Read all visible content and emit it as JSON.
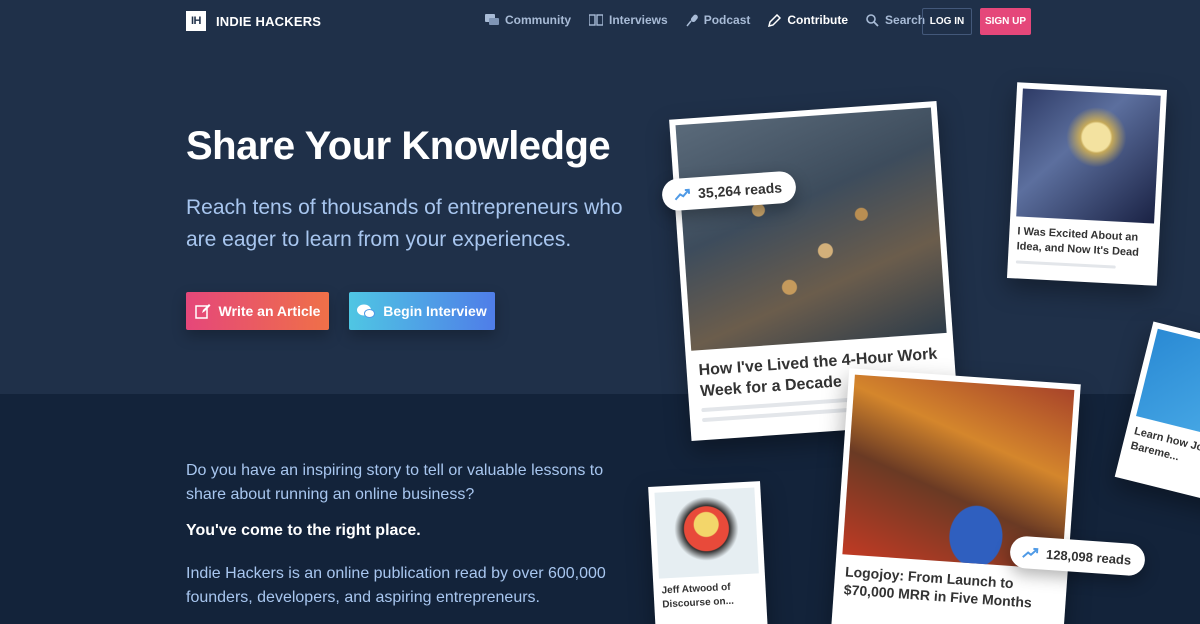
{
  "nav": {
    "logo_mark": "IH",
    "brand": "INDIE HACKERS",
    "links": [
      {
        "label": "Community",
        "icon": "chat-icon"
      },
      {
        "label": "Interviews",
        "icon": "book-icon"
      },
      {
        "label": "Podcast",
        "icon": "microphone-icon"
      },
      {
        "label": "Contribute",
        "icon": "pencil-icon",
        "active": true
      },
      {
        "label": "Search",
        "icon": "search-icon"
      }
    ],
    "login": "LOG IN",
    "signup": "SIGN UP"
  },
  "hero": {
    "title": "Share Your Knowledge",
    "subtitle": "Reach tens of thousands of entrepreneurs who are eager to learn from your experiences.",
    "write_button": "Write an Article",
    "interview_button": "Begin Interview"
  },
  "body": {
    "question": "Do you have an inspiring story to tell or valuable lessons to share about running an online business?",
    "right_place": "You've come to the right place.",
    "publication": "Indie Hackers is an online publication read by over 600,000 founders, developers, and aspiring entrepreneurs."
  },
  "cards": {
    "main": "How I've Lived the 4-Hour Work Week for a Decade",
    "excited": "I Was Excited About an Idea, and Now It's Dead",
    "logojoy": "Logojoy: From Launch to $70,000 MRR in Five Months",
    "atwood": "Jeff Atwood of Discourse on...",
    "baremetrics": "Learn how Jo... Grew Bareme..."
  },
  "badges": {
    "reads_1": "35,264 reads",
    "reads_2": "128,098 reads"
  },
  "colors": {
    "hero_bg": "#1f3049",
    "lower_bg": "#13233a",
    "signup": "#e5477a",
    "accent_blue": "#4f7de8"
  }
}
